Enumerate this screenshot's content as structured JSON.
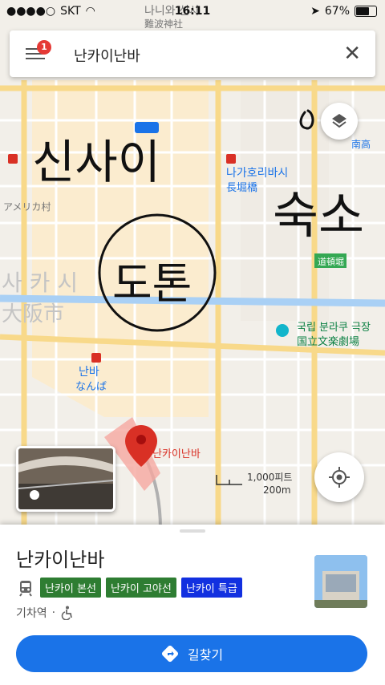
{
  "statusbar": {
    "carrier": "SKT",
    "time": "16:11",
    "battery": "67%",
    "battery_level": 0.67
  },
  "search": {
    "query": "난카이난바",
    "menu_badge": "1"
  },
  "map": {
    "labels": {
      "nishi_sinsa": "나니와 신사",
      "nishi_sinsa_jp": "難波神社",
      "nagahoribashi": "나가호리바시",
      "nagahoribashi_jp": "長堀橋",
      "america_mura": "アメリカ村",
      "osaka_city_ko": "사 카 시",
      "osaka_city_jp": "大阪市",
      "bunraku": "국립 분라쿠 극장",
      "bunraku_jp": "国立文楽劇場",
      "namba": "난바",
      "namba_jp": "なんば",
      "dotonbori_jp": "道頓堀",
      "nankai_namba": "난카이난바",
      "minamitaka": "南高"
    },
    "handwriting": {
      "shinsaibashi": "신사이",
      "dotonbori": "도톤",
      "lodging": "숙소"
    },
    "scale": {
      "feet": "1,000피트",
      "meters": "200m"
    }
  },
  "place": {
    "title": "난카이난바",
    "lines": [
      {
        "label": "난카이 본선",
        "color": "#2e7d32"
      },
      {
        "label": "난카이 고야선",
        "color": "#2e7d32"
      },
      {
        "label": "난카이 특급",
        "color": "#1230e0"
      }
    ],
    "type": "기차역",
    "separator": "·",
    "directions_label": "길찾기"
  },
  "colors": {
    "accent": "#1a73e8",
    "pin": "#d93025"
  }
}
